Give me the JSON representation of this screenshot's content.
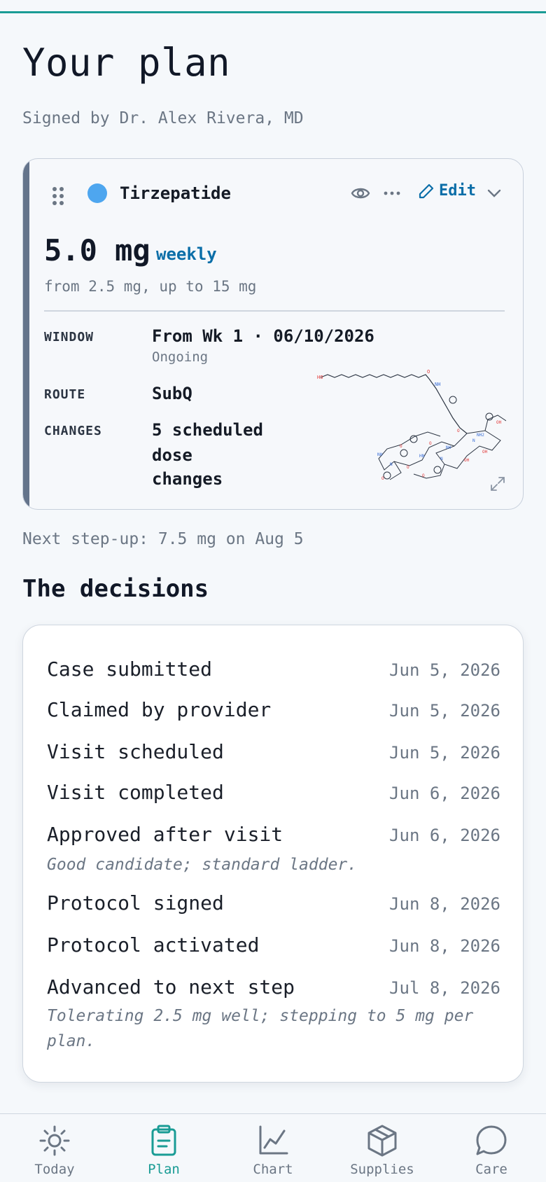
{
  "page": {
    "title": "Your plan",
    "subtitle": "Signed by Dr. Alex Rivera, MD",
    "accent_color": "#1a9c95"
  },
  "medication": {
    "name": "Tirzepatide",
    "dot_color": "#4ea6ef",
    "edit_label": "Edit",
    "dose": "5.0 mg",
    "frequency": "weekly",
    "range": "from 2.5 mg, up to 15 mg",
    "window_label": "WINDOW",
    "window_value": "From Wk 1 · 06/10/2026",
    "window_sub": "Ongoing",
    "route_label": "ROUTE",
    "route_value": "SubQ",
    "changes_label": "CHANGES",
    "changes_line1": "5 scheduled",
    "changes_line2": "dose",
    "changes_line3": "changes",
    "icons": [
      "drag-handle-icon",
      "eye-icon",
      "more-icon",
      "pencil-icon",
      "chevron-down-icon",
      "expand-icon"
    ]
  },
  "next_step": "Next step-up: 7.5 mg on Aug 5",
  "decisions": {
    "title": "The decisions",
    "events": [
      {
        "label": "Case submitted",
        "date": "Jun 5, 2026"
      },
      {
        "label": "Claimed by provider",
        "date": "Jun 5, 2026"
      },
      {
        "label": "Visit scheduled",
        "date": "Jun 5, 2026"
      },
      {
        "label": "Visit completed",
        "date": "Jun 6, 2026"
      },
      {
        "label": "Approved after visit",
        "date": "Jun 6, 2026",
        "note": "Good candidate; standard ladder."
      },
      {
        "label": "Protocol signed",
        "date": "Jun 8, 2026"
      },
      {
        "label": "Protocol activated",
        "date": "Jun 8, 2026"
      },
      {
        "label": "Advanced to next step",
        "date": "Jul 8, 2026",
        "note": "Tolerating 2.5 mg well; stepping to 5 mg per plan."
      }
    ]
  },
  "nav": {
    "items": [
      {
        "label": "Today",
        "icon": "sun-icon"
      },
      {
        "label": "Plan",
        "icon": "clipboard-icon",
        "active": true
      },
      {
        "label": "Chart",
        "icon": "chart-icon"
      },
      {
        "label": "Supplies",
        "icon": "box-icon"
      },
      {
        "label": "Care",
        "icon": "chat-icon"
      }
    ]
  }
}
